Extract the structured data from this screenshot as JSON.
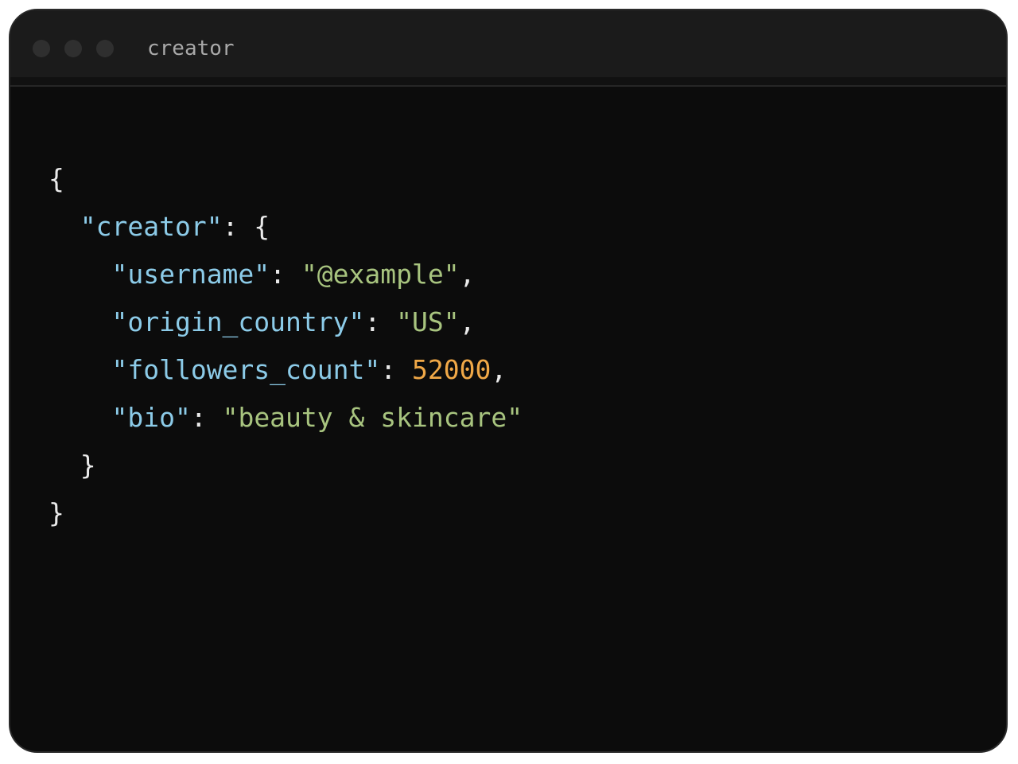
{
  "window": {
    "title": "creator",
    "controls": [
      {
        "name": "close",
        "color": "#2f2f2f"
      },
      {
        "name": "minimize",
        "color": "#2f2f2f"
      },
      {
        "name": "maximize",
        "color": "#2f2f2f"
      }
    ]
  },
  "code": {
    "open_brace": "{",
    "creator_key": "\"creator\"",
    "creator_open": ": {",
    "fields": [
      {
        "key": "\"username\"",
        "sep": ": ",
        "value": "\"@example\"",
        "value_type": "string",
        "trail": ","
      },
      {
        "key": "\"origin_country\"",
        "sep": ": ",
        "value": "\"US\"",
        "value_type": "string",
        "trail": ","
      },
      {
        "key": "\"followers_count\"",
        "sep": ": ",
        "value": "52000",
        "value_type": "number",
        "trail": ","
      },
      {
        "key": "\"bio\"",
        "sep": ": ",
        "value": "\"beauty & skincare\"",
        "value_type": "string",
        "trail": ""
      }
    ],
    "creator_close": "}",
    "close_brace": "}"
  },
  "colors": {
    "window_bg": "#0c0c0c",
    "titlebar_bg": "#1b1b1b",
    "key": "#8ccbe8",
    "string": "#a8c47f",
    "number": "#f0a847",
    "punctuation": "#eaeaea"
  }
}
